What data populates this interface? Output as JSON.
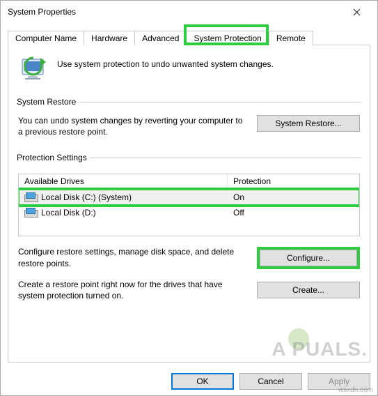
{
  "window": {
    "title": "System Properties"
  },
  "tabs": {
    "items": [
      {
        "label": "Computer Name"
      },
      {
        "label": "Hardware"
      },
      {
        "label": "Advanced"
      },
      {
        "label": "System Protection",
        "active": true
      },
      {
        "label": "Remote"
      }
    ]
  },
  "intro_text": "Use system protection to undo unwanted system changes.",
  "system_restore": {
    "legend": "System Restore",
    "text": "You can undo system changes by reverting your computer to a previous restore point.",
    "button": "System Restore..."
  },
  "protection_settings": {
    "legend": "Protection Settings",
    "columns": {
      "drives": "Available Drives",
      "protection": "Protection"
    },
    "drives": [
      {
        "name": "Local Disk (C:) (System)",
        "protection": "On",
        "selected": true
      },
      {
        "name": "Local Disk (D:)",
        "protection": "Off",
        "selected": false
      }
    ],
    "configure_text": "Configure restore settings, manage disk space, and delete restore points.",
    "configure_button": "Configure...",
    "create_text": "Create a restore point right now for the drives that have system protection turned on.",
    "create_button": "Create..."
  },
  "dialog_buttons": {
    "ok": "OK",
    "cancel": "Cancel",
    "apply": "Apply"
  },
  "watermark": "A  PUALS.",
  "sourcemark": "wsxdn.com"
}
